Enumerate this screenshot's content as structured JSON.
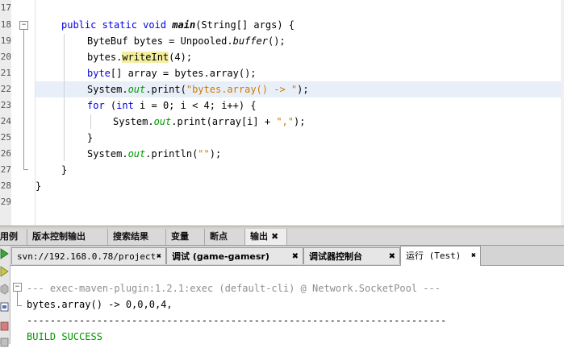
{
  "editor": {
    "line_numbers": [
      "17",
      "18",
      "19",
      "20",
      "21",
      "22",
      "23",
      "24",
      "25",
      "26",
      "27",
      "28",
      "29"
    ],
    "fold_markers": [
      "−",
      "−"
    ],
    "lines": {
      "l18": {
        "kw1": "public static void ",
        "method": "main",
        "rest": "(String[] args) {"
      },
      "l19": {
        "pre": "ByteBuf bytes = Unpooled.",
        "call": "buffer",
        "post": "();"
      },
      "l20": {
        "pre": "bytes.",
        "hl": "writeInt",
        "post": "(4);"
      },
      "l21": {
        "kw": "byte",
        "post": "[] array = bytes.array();"
      },
      "l22": {
        "pre": "System.",
        "fld": "out",
        "mid": ".print(",
        "str": "\"bytes.array() -> \"",
        "post": ");"
      },
      "l23": {
        "kw1": "for",
        "a": " (",
        "kw2": "int",
        "b": " i = 0; i < 4; i++) {"
      },
      "l24": {
        "pre": "System.",
        "fld": "out",
        "mid": ".print(array[i] + ",
        "str": "\",\"",
        "post": ");"
      },
      "l25": {
        "text": "}"
      },
      "l26": {
        "pre": "System.",
        "fld": "out",
        "mid": ".println(",
        "str": "\"\"",
        "post": ");"
      },
      "l27": {
        "text": "}"
      },
      "l28": {
        "text": "}"
      }
    }
  },
  "panel_tabs": [
    {
      "label": "用例",
      "close": ""
    },
    {
      "label": "版本控制输出",
      "close": ""
    },
    {
      "label": "搜索结果",
      "close": ""
    },
    {
      "label": "变量",
      "close": ""
    },
    {
      "label": "断点",
      "close": ""
    },
    {
      "label": "输出",
      "close": "✖"
    }
  ],
  "output_tabs": [
    {
      "label": "svn://192.168.0.78/project",
      "close": "✖"
    },
    {
      "label": "调试 (game-gamesr)",
      "close": "✖"
    },
    {
      "label": "调试器控制台",
      "close": "✖"
    },
    {
      "label": "运行 (Test)",
      "close": "✖"
    }
  ],
  "output": {
    "fold_marker": "−",
    "lines": [
      "--- exec-maven-plugin:1.2.1:exec (default-cli) @ Network.SocketPool ---",
      "bytes.array() -> 0,0,0,4,",
      "------------------------------------------------------------------------",
      "BUILD SUCCESS"
    ]
  },
  "colors": {
    "keyword": "#0000e6",
    "string": "#ce7b00",
    "field": "#009900",
    "build_success": "#009600",
    "current_line": "#e9eff8"
  }
}
